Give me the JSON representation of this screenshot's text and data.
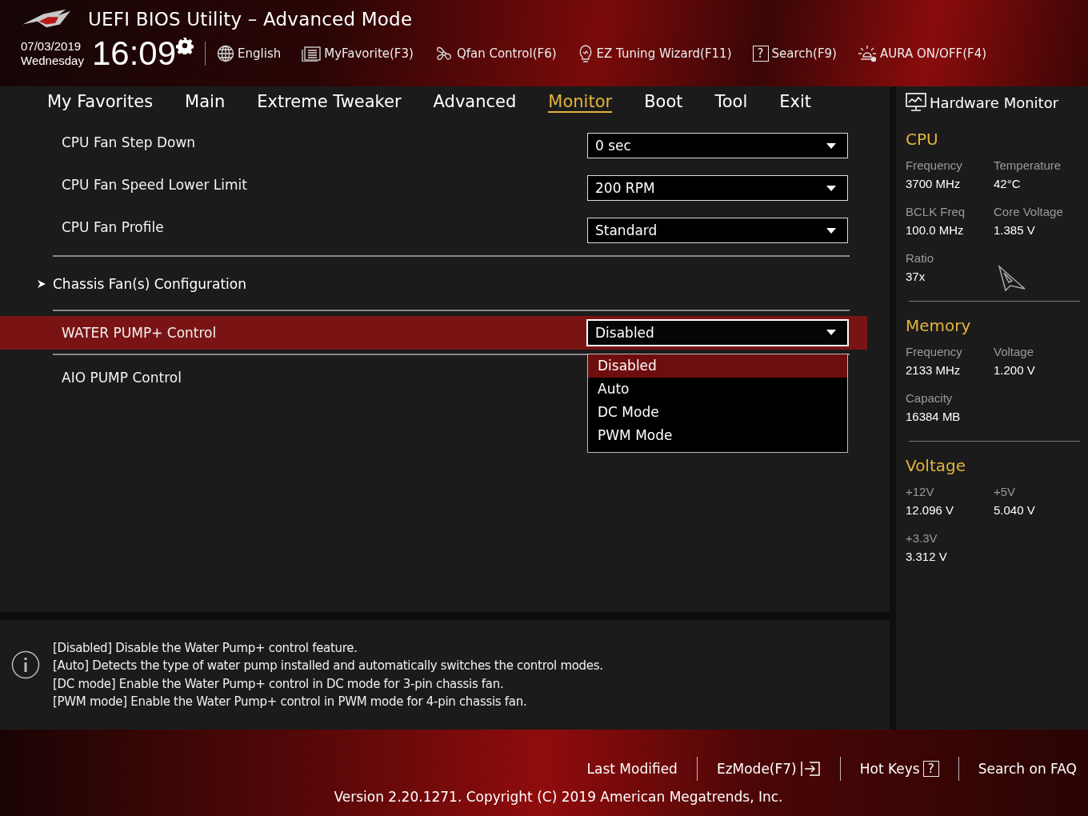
{
  "window": {
    "title": "UEFI BIOS Utility – Advanced Mode"
  },
  "clock": {
    "date": "07/03/2019",
    "day": "Wednesday",
    "time": "16:09"
  },
  "toolbar": [
    {
      "label": "English"
    },
    {
      "label": "MyFavorite(F3)"
    },
    {
      "label": "Qfan Control(F6)"
    },
    {
      "label": "EZ Tuning Wizard(F11)"
    },
    {
      "label": "Search(F9)",
      "glyph": "?"
    },
    {
      "label": "AURA ON/OFF(F4)"
    }
  ],
  "tabs": [
    {
      "label": "My Favorites",
      "selected": false
    },
    {
      "label": "Main",
      "selected": false
    },
    {
      "label": "Extreme Tweaker",
      "selected": false
    },
    {
      "label": "Advanced",
      "selected": false
    },
    {
      "label": "Monitor",
      "selected": true
    },
    {
      "label": "Boot",
      "selected": false
    },
    {
      "label": "Tool",
      "selected": false
    },
    {
      "label": "Exit",
      "selected": false
    }
  ],
  "settings": [
    {
      "kind": "select",
      "label": "CPU Fan Step Down",
      "value": "0 sec",
      "selected": false,
      "expanded": false
    },
    {
      "kind": "select",
      "label": "CPU Fan Speed Lower Limit",
      "value": "200 RPM",
      "selected": false,
      "expanded": false
    },
    {
      "kind": "select",
      "label": "CPU Fan Profile",
      "value": "Standard",
      "selected": false,
      "expanded": false
    },
    {
      "kind": "divider"
    },
    {
      "kind": "submenu",
      "label": "Chassis Fan(s) Configuration"
    },
    {
      "kind": "divider"
    },
    {
      "kind": "select",
      "label": "WATER PUMP+ Control",
      "value": "Disabled",
      "selected": true,
      "expanded": true,
      "options": [
        {
          "label": "Disabled",
          "selected": true
        },
        {
          "label": "Auto",
          "selected": false
        },
        {
          "label": "DC Mode",
          "selected": false
        },
        {
          "label": "PWM Mode",
          "selected": false
        }
      ]
    },
    {
      "kind": "divider"
    },
    {
      "kind": "item",
      "label": "AIO PUMP Control"
    }
  ],
  "help": [
    "[Disabled] Disable the Water Pump+ control feature.",
    "[Auto] Detects the type of water pump installed and automatically switches the control modes.",
    "[DC mode] Enable the Water Pump+ control in DC mode for 3-pin chassis fan.",
    "[PWM mode] Enable the Water Pump+ control in PWM mode for 4-pin chassis fan."
  ],
  "hardware_monitor": {
    "title": "Hardware Monitor",
    "sections": [
      {
        "title": "CPU",
        "items": [
          {
            "label": "Frequency",
            "value": "3700 MHz"
          },
          {
            "label": "Temperature",
            "value": "42°C"
          },
          {
            "label": "BCLK Freq",
            "value": "100.0 MHz"
          },
          {
            "label": "Core Voltage",
            "value": "1.385 V"
          },
          {
            "label": "Ratio",
            "value": "37x"
          }
        ]
      },
      {
        "title": "Memory",
        "items": [
          {
            "label": "Frequency",
            "value": "2133 MHz"
          },
          {
            "label": "Voltage",
            "value": "1.200 V"
          },
          {
            "label": "Capacity",
            "value": "16384 MB"
          }
        ]
      },
      {
        "title": "Voltage",
        "items": [
          {
            "label": "+12V",
            "value": "12.096 V"
          },
          {
            "label": "+5V",
            "value": "5.040 V"
          },
          {
            "label": "+3.3V",
            "value": "3.312 V"
          }
        ]
      }
    ]
  },
  "footer": {
    "links": [
      {
        "label": "Last Modified"
      },
      {
        "label": "EzMode(F7)"
      },
      {
        "label": "Hot Keys",
        "glyph": "?"
      },
      {
        "label": "Search on FAQ"
      }
    ],
    "version": "Version 2.20.1271. Copyright (C) 2019 American Megatrends, Inc."
  }
}
